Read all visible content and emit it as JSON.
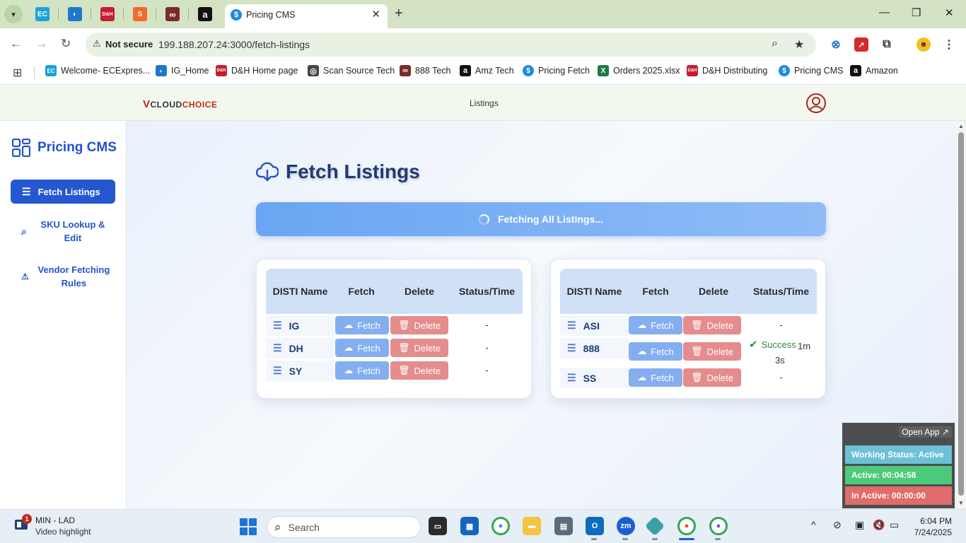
{
  "browser": {
    "active_tab_title": "Pricing CMS",
    "tab_favicon_glyph": "$",
    "close_glyph": "✕",
    "new_tab_glyph": "+",
    "security_label": "Not secure",
    "url": "199.188.207.24:3000/fetch-listings",
    "pinned_tabs": [
      {
        "icon": "ecexpress-icon",
        "glyph": "EC",
        "color": "#1aa3d9"
      },
      {
        "icon": "edge-blue-icon",
        "glyph": "◐",
        "color": "#1f78c8"
      },
      {
        "icon": "dh-icon",
        "glyph": "D&H",
        "color": "#c21f2f"
      },
      {
        "icon": "sublime-icon",
        "glyph": "S",
        "color": "#f26b2a"
      },
      {
        "icon": "888-icon",
        "glyph": "∞",
        "color": "#7a2a2a"
      },
      {
        "icon": "amazon-icon",
        "glyph": "a",
        "color": "#111111"
      }
    ],
    "bookmarks": [
      {
        "label": "Welcome- ECExpres...",
        "icon": "ecexpress-icon",
        "glyph": "EC",
        "color": "#1aa3d9"
      },
      {
        "label": "IG_Home",
        "icon": "ig-icon",
        "glyph": "◐",
        "color": "#1f78c8"
      },
      {
        "label": "D&H Home page",
        "icon": "dh-icon",
        "glyph": "D&H",
        "color": "#c21f2f"
      },
      {
        "label": "Scan Source Tech",
        "icon": "globe-icon",
        "glyph": "◎",
        "color": "#444444"
      },
      {
        "label": "888 Tech",
        "icon": "888-icon",
        "glyph": "∞",
        "color": "#7a2a2a"
      },
      {
        "label": "Amz Tech",
        "icon": "amazon-icon",
        "glyph": "a",
        "color": "#111111"
      },
      {
        "label": "Pricing Fetch",
        "icon": "dollar-icon",
        "glyph": "$",
        "color": "#1a8ae5"
      },
      {
        "label": "Orders 2025.xlsx",
        "icon": "excel-icon",
        "glyph": "X",
        "color": "#1f7a44"
      },
      {
        "label": "D&H Distributing",
        "icon": "dh-icon",
        "glyph": "D&H",
        "color": "#c21f2f"
      },
      {
        "label": "Pricing CMS",
        "icon": "dollar-icon",
        "glyph": "$",
        "color": "#1a8ae5"
      },
      {
        "label": "Amazon",
        "icon": "amazon-icon",
        "glyph": "a",
        "color": "#111111"
      }
    ]
  },
  "header": {
    "logo_v": "V",
    "logo_cloud": "CLOUD",
    "logo_choice": "CHOICE",
    "nav_label": "Listings"
  },
  "sidebar": {
    "brand": "Pricing CMS",
    "items": [
      {
        "label": "Fetch Listings",
        "icon": "list-icon",
        "active": true
      },
      {
        "label": "SKU Lookup & Edit",
        "icon": "search-icon",
        "active": false
      },
      {
        "label": "Vendor Fetching Rules",
        "icon": "warning-icon",
        "active": false
      }
    ]
  },
  "main": {
    "title": "Fetch Listings",
    "fetch_all_label": "Fetching All Listings...",
    "columns": {
      "name": "DISTI Name",
      "fetch": "Fetch",
      "delete": "Delete",
      "status": "Status/Time"
    },
    "fetch_label": "Fetch",
    "delete_label": "Delete",
    "left_rows": [
      {
        "name": "IG",
        "status": "-"
      },
      {
        "name": "DH",
        "status": "-"
      },
      {
        "name": "SY",
        "status": "-"
      }
    ],
    "right_rows": [
      {
        "name": "ASI",
        "status": "-"
      },
      {
        "name": "888",
        "status": "Success",
        "time_a": "1m",
        "time_b": "3s"
      },
      {
        "name": "SS",
        "status": "-"
      }
    ]
  },
  "widget": {
    "open_app": "Open App ↗",
    "working_status": "Working Status: Active",
    "active": "Active: 00:04:58",
    "inactive": "In Active: 00:00:00",
    "colors": {
      "working": "#6cc1d6",
      "active": "#4cc97a",
      "inactive": "#e06c6c"
    }
  },
  "taskbar": {
    "weather_badge": "1",
    "weather_title": "MIN - LAD",
    "weather_sub": "Video highlight",
    "search_placeholder": "Search",
    "time": "6:04 PM",
    "date": "7/24/2025"
  },
  "colors": {
    "accent": "#2457d0",
    "fetch_button": "#84aef0",
    "delete_button": "#e58c8c",
    "success": "#2f8a3b"
  }
}
